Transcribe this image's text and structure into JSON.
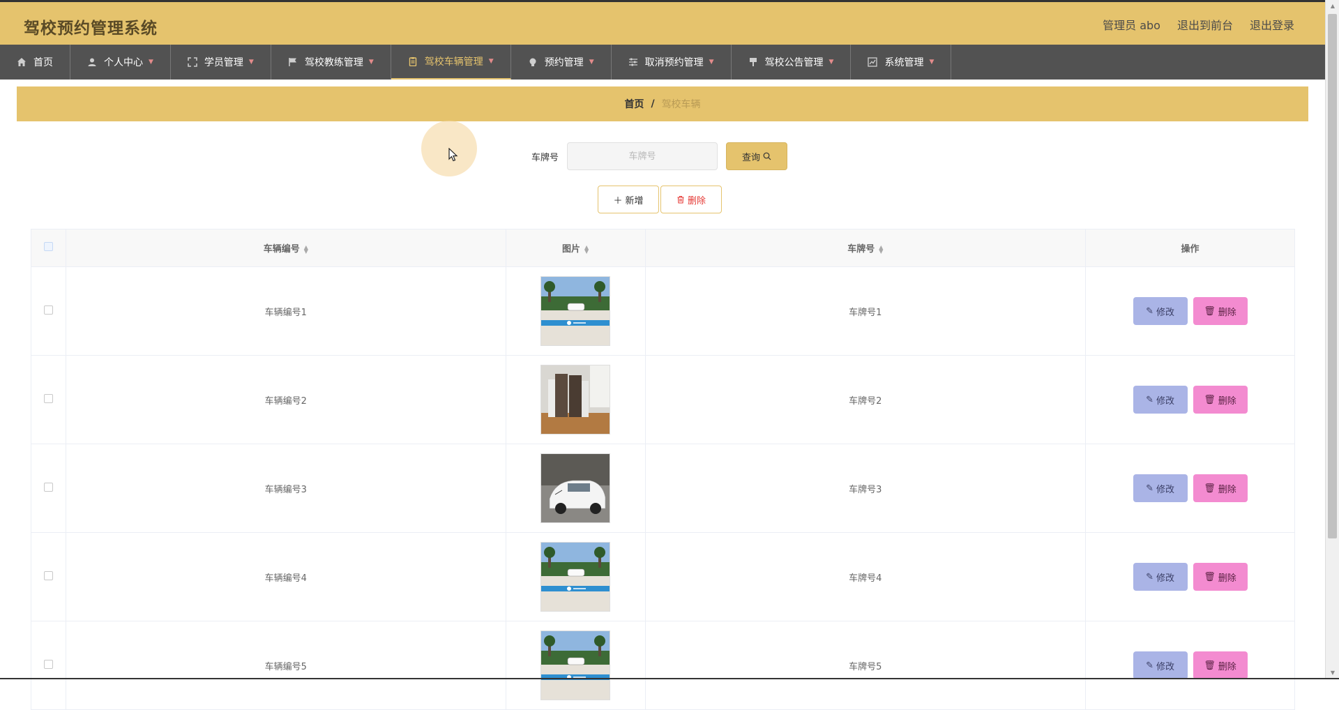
{
  "header": {
    "app_title": "驾校预约管理系统",
    "user_label": "管理员 abo",
    "back_to_front": "退出到前台",
    "logout": "退出登录"
  },
  "nav": {
    "items": [
      {
        "label": "首页",
        "icon": "home-icon"
      },
      {
        "label": "个人中心",
        "icon": "user-icon"
      },
      {
        "label": "学员管理",
        "icon": "fullscreen-icon"
      },
      {
        "label": "驾校教练管理",
        "icon": "flag-icon"
      },
      {
        "label": "驾校车辆管理",
        "icon": "clipboard-icon",
        "active": true
      },
      {
        "label": "预约管理",
        "icon": "bulb-icon"
      },
      {
        "label": "取消预约管理",
        "icon": "sliders-icon"
      },
      {
        "label": "驾校公告管理",
        "icon": "brush-icon"
      },
      {
        "label": "系统管理",
        "icon": "chart-icon"
      }
    ]
  },
  "breadcrumb": {
    "home": "首页",
    "separator": "/",
    "current": "驾校车辆"
  },
  "search": {
    "label": "车牌号",
    "placeholder": "车牌号",
    "button": "查询"
  },
  "actions": {
    "add": "新增",
    "delete": "删除"
  },
  "table": {
    "headers": {
      "vehicle_no": "车辆编号",
      "image": "图片",
      "plate": "车牌号",
      "ops": "操作"
    },
    "rows": [
      {
        "vehicle_no": "车辆编号1",
        "plate": "车牌号1",
        "image": "car-on-training-ground"
      },
      {
        "vehicle_no": "车辆编号2",
        "plate": "车牌号2",
        "image": "driving-simulator-seats"
      },
      {
        "vehicle_no": "车辆编号3",
        "plate": "车牌号3",
        "image": "white-training-car"
      },
      {
        "vehicle_no": "车辆编号4",
        "plate": "车牌号4",
        "image": "car-on-training-ground"
      },
      {
        "vehicle_no": "车辆编号5",
        "plate": "车牌号5",
        "image": "car-on-training-ground"
      }
    ],
    "edit_label": "修改",
    "delete_label": "删除"
  },
  "colors": {
    "accent": "#e5c36d",
    "nav_bg": "#525252",
    "edit_btn": "#aab4e6",
    "delete_btn": "#f38bd0"
  }
}
